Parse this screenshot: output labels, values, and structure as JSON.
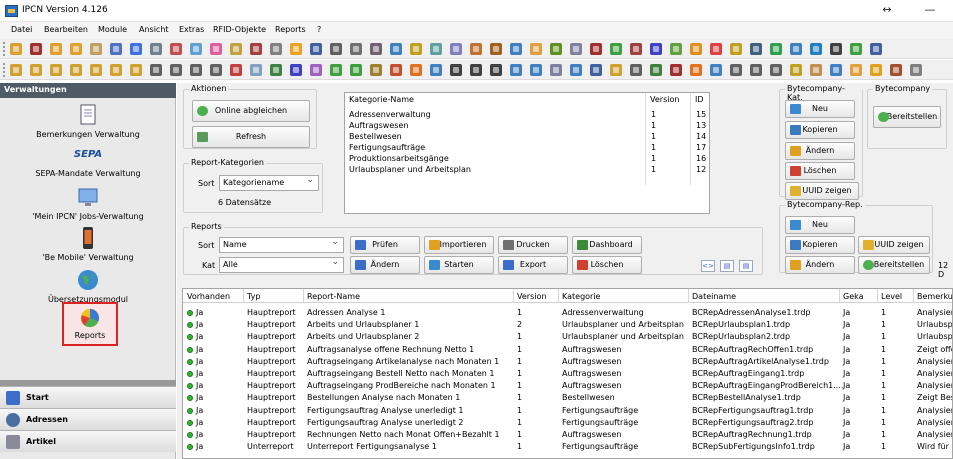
{
  "window": {
    "title": "IPCN Version 4.126",
    "move_glyph": "↔",
    "minimize_glyph": "—"
  },
  "menu": [
    "Datei",
    "Bearbeiten",
    "Module",
    "Ansicht",
    "Extras",
    "RFID-Objekte",
    "Reports",
    "?"
  ],
  "toolbar_colors": {
    "row1": [
      "#d9a030",
      "#a03030",
      "#e0a030",
      "#e0a030",
      "#c0a060",
      "#5070c0",
      "#4070e0",
      "#708090",
      "#c05050",
      "#60a0d0",
      "#e060a0",
      "#c0a040",
      "#a04040",
      "#808080",
      "#f0a020",
      "#4060a0",
      "#606060",
      "#707070",
      "#706070",
      "#4080c0",
      "#c0a020",
      "#60a0a0",
      "#8080c0",
      "#c07030",
      "#a06020",
      "#4080c0",
      "#e0a040",
      "#609020",
      "#8080a0",
      "#a03030",
      "#40a040",
      "#a04040",
      "#4040c0",
      "#60a040",
      "#e09020",
      "#e04040",
      "#c0a020",
      "#406080",
      "#30a050",
      "#4080c0",
      "#2080c0",
      "#404040",
      "#40a040",
      "#4060a0"
    ],
    "row2": [
      "#d0a030",
      "#d0a030",
      "#d0a030",
      "#d0a030",
      "#d0a030",
      "#d0a030",
      "#d0a030",
      "#606060",
      "#606060",
      "#606060",
      "#606060",
      "#c04040",
      "#80a0c0",
      "#408040",
      "#4040c0",
      "#a060c0",
      "#40a040",
      "#40a040",
      "#a08030",
      "#c05030",
      "#e07020",
      "#4080c0",
      "#404040",
      "#404040",
      "#404040",
      "#4080c0",
      "#4080c0",
      "#8080a0",
      "#4080c0",
      "#4060a0",
      "#d0a030",
      "#606060",
      "#408040",
      "#a03030",
      "#e07020",
      "#4080c0",
      "#606060",
      "#606060",
      "#606060",
      "#c0a020",
      "#c09050",
      "#4080c0",
      "#e0a040",
      "#e0a020",
      "#a05030",
      "#808080"
    ]
  },
  "left": {
    "header": "Verwaltungen",
    "modules": [
      {
        "label": "Bemerkungen Verwaltung",
        "icon": "document-icon"
      },
      {
        "label": "SEPA-Mandate Verwaltung",
        "icon": "sepa-logo-icon",
        "logo": "SEPA"
      },
      {
        "label": "'Mein IPCN' Jobs-Verwaltung",
        "icon": "monitor-icon"
      },
      {
        "label": "'Be Mobile' Verwaltung",
        "icon": "mobile-phone-icon"
      },
      {
        "label": "Übersetzungsmodul",
        "icon": "globe-icon"
      },
      {
        "label": "Reports",
        "icon": "pie-chart-icon"
      }
    ],
    "nav": [
      "Start",
      "Adressen",
      "Artikel"
    ]
  },
  "aktionen": {
    "title": "Aktionen",
    "online": "Online abgleichen",
    "refresh": "Refresh"
  },
  "report_kategorien": {
    "title": "Report-Kategorien",
    "sort_label": "Sort",
    "sort_value": "Kategoriename",
    "count": "6 Datensätze"
  },
  "kategorie_grid": {
    "headers": [
      "Kategorie-Name",
      "Version",
      "ID"
    ],
    "rows": [
      [
        "Adressenverwaltung",
        "1",
        "15"
      ],
      [
        "Auftragswesen",
        "1",
        "13"
      ],
      [
        "Bestellwesen",
        "1",
        "14"
      ],
      [
        "Fertigungsaufträge",
        "1",
        "17"
      ],
      [
        "Produktionsarbeitsgänge",
        "1",
        "16"
      ],
      [
        "Urlaubsplaner und Arbeitsplan",
        "1",
        "12"
      ]
    ]
  },
  "bytecompany_kat": {
    "title": "Bytecompany-Kat.",
    "buttons": [
      "Neu",
      "Kopieren",
      "Ändern",
      "Löschen",
      "UUID zeigen"
    ]
  },
  "bytecompany": {
    "title": "Bytecompany",
    "button": "Bereitstellen"
  },
  "bytecompany_rep": {
    "title": "Bytecompany-Rep.",
    "buttons": [
      "Neu",
      "Kopieren",
      "UUID zeigen",
      "Ändern",
      "Bereitstellen"
    ],
    "extra": "12 D"
  },
  "reports": {
    "title": "Reports",
    "sort_label": "Sort",
    "sort_value": "Name",
    "kat_label": "Kat",
    "kat_value": "Alle",
    "buttons": [
      "Prüfen",
      "Importieren",
      "Drucken",
      "Dashboard",
      "Ändern",
      "Starten",
      "Export",
      "Löschen"
    ],
    "small_icons": [
      "<>",
      "▤",
      "▤"
    ]
  },
  "report_grid": {
    "headers": [
      "Vorhanden",
      "Typ",
      "Report-Name",
      "Version",
      "Kategorie",
      "Dateiname",
      "Geka",
      "Level",
      "Bemerkun"
    ],
    "rows": [
      [
        "Ja",
        "Hauptreport",
        "Adressen Analyse 1",
        "1",
        "Adressenverwaltung",
        "BCRepAdressenAnalyse1.trdp",
        "Ja",
        "1",
        "Analysiert"
      ],
      [
        "Ja",
        "Hauptreport",
        "Arbeits und Urlaubsplaner 1",
        "2",
        "Urlaubsplaner und Arbeitsplan",
        "BCRepUrlaubsplan1.trdp",
        "Ja",
        "1",
        "Urlaubspla"
      ],
      [
        "Ja",
        "Hauptreport",
        "Arbeits und Urlaubsplaner 2",
        "1",
        "Urlaubsplaner und Arbeitsplan",
        "BCRepUrlaubsplan2.trdp",
        "Ja",
        "1",
        "Urlaubspla"
      ],
      [
        "Ja",
        "Hauptreport",
        "Auftragsanalyse offene Rechnung Netto 1",
        "1",
        "Auftragswesen",
        "BCRepAuftragRechOffen1.trdp",
        "Ja",
        "1",
        "Zeigt offe"
      ],
      [
        "Ja",
        "Hauptreport",
        "Auftragseingang Artikelanalyse nach Monaten 1",
        "1",
        "Auftragswesen",
        "BCRepAuftragArtikelAnalyse1.trdp",
        "Ja",
        "1",
        "Analysiert"
      ],
      [
        "Ja",
        "Hauptreport",
        "Auftragseingang Bestell Netto  nach Monaten 1",
        "1",
        "Auftragswesen",
        "BCRepAuftragEingang1.trdp",
        "Ja",
        "1",
        "Analysiert"
      ],
      [
        "Ja",
        "Hauptreport",
        "Auftragseingang ProdBereiche nach Monaten 1",
        "1",
        "Auftragswesen",
        "BCRepAuftragEingangProdBereich1....",
        "Ja",
        "1",
        "Analysiert"
      ],
      [
        "Ja",
        "Hauptreport",
        "Bestellungen Analyse nach Monaten 1",
        "1",
        "Bestellwesen",
        "BCRepBestellAnalyse1.trdp",
        "Ja",
        "1",
        "Zeigt Best"
      ],
      [
        "Ja",
        "Hauptreport",
        "Fertigungsauftrag Analyse unerledigt 1",
        "1",
        "Fertigungsaufträge",
        "BCRepFertigungsauftrag1.trdp",
        "Ja",
        "1",
        "Analysiert"
      ],
      [
        "Ja",
        "Hauptreport",
        "Fertigungsauftrag Analyse unerledigt 2",
        "1",
        "Fertigungsaufträge",
        "BCRepFertigungsauftrag2.trdp",
        "Ja",
        "1",
        "Analysiert"
      ],
      [
        "Ja",
        "Hauptreport",
        "Rechnungen Netto nach Monat Offen+Bezahlt 1",
        "1",
        "Auftragswesen",
        "BCRepAuftragRechnung1.trdp",
        "Ja",
        "1",
        "Analysiert"
      ],
      [
        "Ja",
        "Unterreport",
        "Unterreport Fertigungsanalyse 1",
        "1",
        "Fertigungsaufträge",
        "BCRepSubFertigungsInfo1.trdp",
        "Ja",
        "1",
        "Wird für d"
      ]
    ]
  }
}
